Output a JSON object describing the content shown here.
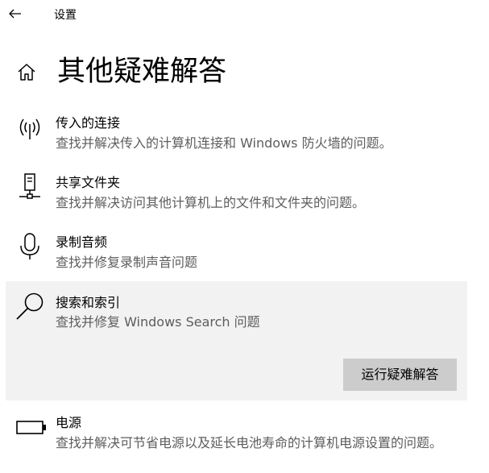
{
  "window": {
    "app_title": "设置",
    "back_icon": "back-arrow-icon"
  },
  "page": {
    "title": "其他疑难解答",
    "home_icon": "home-icon"
  },
  "items": [
    {
      "icon": "wireless-antenna-icon",
      "title": "传入的连接",
      "description": "查找并解决传入的计算机连接和 Windows 防火墙的问题。"
    },
    {
      "icon": "network-server-icon",
      "title": "共享文件夹",
      "description": "查找并解决访问其他计算机上的文件和文件夹的问题。"
    },
    {
      "icon": "microphone-icon",
      "title": "录制音频",
      "description": "查找并修复录制声音问题"
    },
    {
      "icon": "search-icon",
      "title": "搜索和索引",
      "description": "查找并修复 Windows Search 问题",
      "button_label": "运行疑难解答",
      "selected": true
    },
    {
      "icon": "battery-icon",
      "title": "电源",
      "description": "查找并解决可节省电源以及延长电池寿命的计算机电源设置的问题。"
    }
  ]
}
